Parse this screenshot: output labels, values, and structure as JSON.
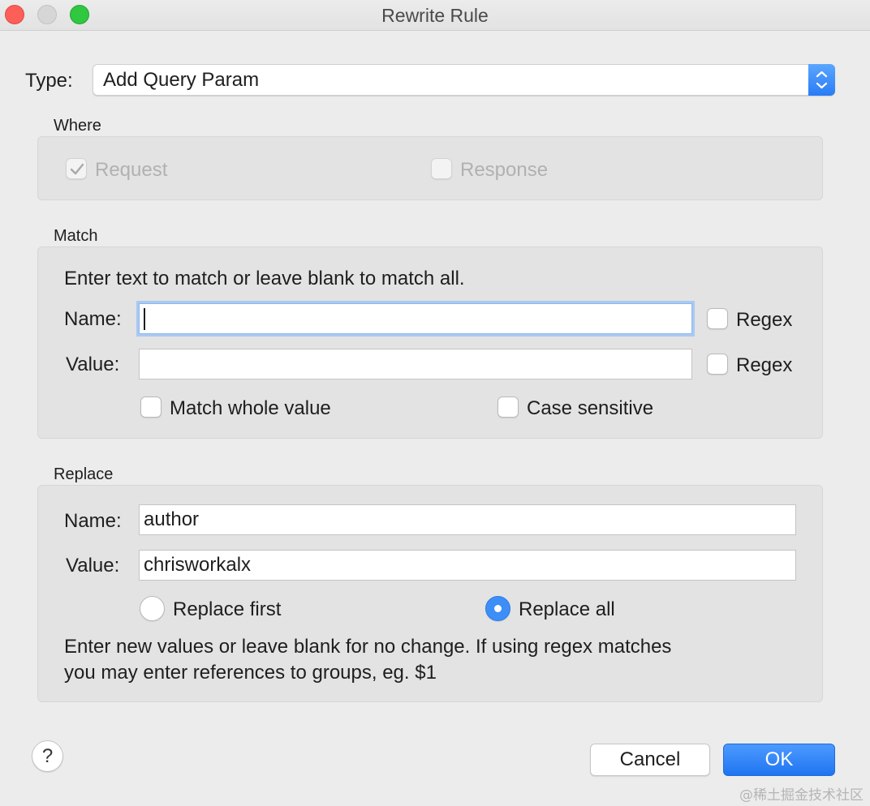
{
  "window": {
    "title": "Rewrite Rule"
  },
  "type": {
    "label": "Type:",
    "value": "Add Query Param"
  },
  "where": {
    "title": "Where",
    "request_label": "Request",
    "request_checked": true,
    "response_label": "Response",
    "response_checked": false
  },
  "match": {
    "title": "Match",
    "hint": "Enter text to match or leave blank to match all.",
    "name_label": "Name:",
    "name_value": "",
    "value_label": "Value:",
    "value_value": "",
    "regex_label": "Regex",
    "match_whole_value_label": "Match whole value",
    "case_sensitive_label": "Case sensitive"
  },
  "replace": {
    "title": "Replace",
    "name_label": "Name:",
    "name_value": "author",
    "value_label": "Value:",
    "value_value": "chrisworkalx",
    "replace_first_label": "Replace first",
    "replace_all_label": "Replace all",
    "selected": "Replace all",
    "hint_line1": "Enter new values or leave blank for no change. If using regex matches",
    "hint_line2": "you may enter references to groups, eg. $1"
  },
  "buttons": {
    "help": "?",
    "cancel": "Cancel",
    "ok": "OK"
  },
  "watermark": "@稀土掘金技术社区",
  "colors": {
    "accent": "#2a7cf5",
    "focus_ring": "#a9c9f2"
  }
}
